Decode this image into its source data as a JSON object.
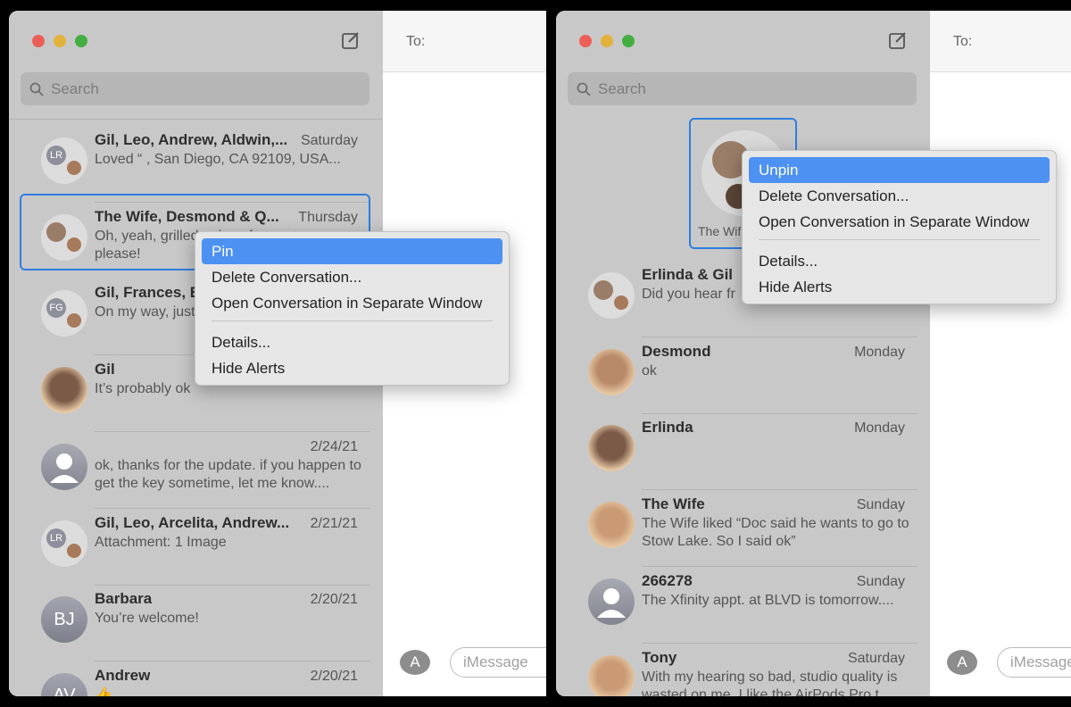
{
  "left": {
    "to_label": "To:",
    "search_placeholder": "Search",
    "conversations": [
      {
        "name": "Gil, Leo, Andrew, Aldwin,...",
        "date": "Saturday",
        "message": "Loved “                        , San Diego, CA 92109, USA...",
        "avatar": "group",
        "initials": "LR"
      },
      {
        "name": "The Wife, Desmond & Q...",
        "date": "Thursday",
        "message": "Oh, yeah, grilled onions for me too please!",
        "avatar": "group-photo",
        "selected": true
      },
      {
        "name": "Gil, Frances, E",
        "date": "",
        "message": "On my way, just",
        "avatar": "group",
        "initials": "FG"
      },
      {
        "name": "Gil",
        "date": "",
        "message": "It’s probably ok",
        "avatar": "photo"
      },
      {
        "name": "",
        "date": "2/24/21",
        "message": "ok, thanks for the update. if you happen to get the key sometime, let me know....",
        "avatar": "person"
      },
      {
        "name": "Gil, Leo, Arcelita, Andrew...",
        "date": "2/21/21",
        "message": "Attachment: 1 Image",
        "avatar": "group",
        "initials": "LR"
      },
      {
        "name": "Barbara",
        "date": "2/20/21",
        "message": "You’re welcome!",
        "avatar": "initials",
        "initials": "BJ"
      },
      {
        "name": "Andrew",
        "date": "2/20/21",
        "message": "👍",
        "avatar": "initials",
        "initials": "AV"
      }
    ],
    "context_menu": [
      "Pin",
      "Delete Conversation...",
      "Open Conversation in Separate Window",
      "Details...",
      "Hide Alerts"
    ],
    "message_placeholder": "iMessage"
  },
  "right": {
    "to_label": "To:",
    "search_placeholder": "Search",
    "pinned": {
      "label": "The Wif"
    },
    "conversations": [
      {
        "name": "Erlinda & Gil",
        "date": "",
        "message": "Did you hear fr",
        "avatar": "group-photo"
      },
      {
        "name": "Desmond",
        "date": "Monday",
        "message": "ok",
        "avatar": "photo"
      },
      {
        "name": "Erlinda",
        "date": "Monday",
        "message": "",
        "avatar": "photo"
      },
      {
        "name": "The Wife",
        "date": "Sunday",
        "message": "The Wife liked “Doc said he wants to go to Stow Lake. So I said ok”",
        "avatar": "photo"
      },
      {
        "name": "266278",
        "date": "Sunday",
        "message": "The Xfinity appt. at BLVD is tomorrow....",
        "avatar": "person"
      },
      {
        "name": "Tony",
        "date": "Saturday",
        "message": "With my hearing so bad, studio quality is wasted on me. I like the AirPods Pro t...",
        "avatar": "photo"
      }
    ],
    "context_menu": [
      "Unpin",
      "Delete Conversation...",
      "Open Conversation in Separate Window",
      "Details...",
      "Hide Alerts"
    ],
    "message_placeholder": "iMessage"
  },
  "colors": {
    "accent": "#2f7de1",
    "highlight": "#4d91f2",
    "sidebar": "#c8c8c8"
  }
}
